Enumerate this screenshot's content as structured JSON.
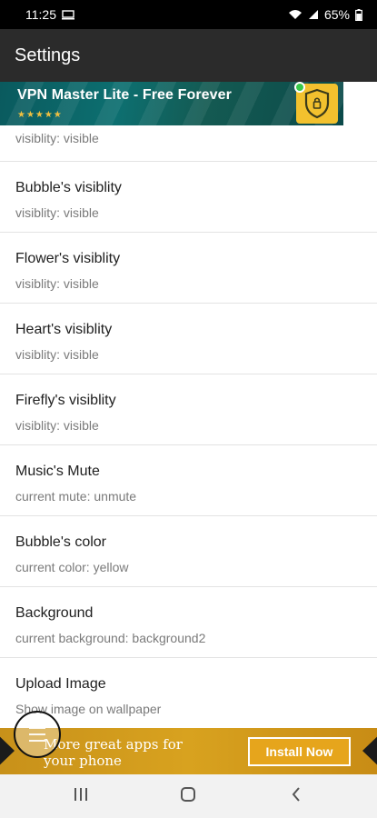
{
  "status_bar": {
    "time": "11:25",
    "battery": "65%",
    "icons": [
      "screen-record-icon",
      "wifi-icon",
      "signal-icon",
      "battery-icon"
    ]
  },
  "app_bar": {
    "title": "Settings"
  },
  "ad_top": {
    "title": "VPN Master Lite - Free Forever",
    "stars": "★★★★★",
    "icon": "shield-lock-icon"
  },
  "settings": {
    "partial_item": {
      "subtitle": "visiblity: visible"
    },
    "items": [
      {
        "title": "Bubble's visiblity",
        "subtitle": "visiblity: visible"
      },
      {
        "title": "Flower's visiblity",
        "subtitle": "visiblity: visible"
      },
      {
        "title": "Heart's visiblity",
        "subtitle": "visiblity: visible"
      },
      {
        "title": "Firefly's visiblity",
        "subtitle": "visiblity: visible"
      },
      {
        "title": "Music's Mute",
        "subtitle": "current mute: unmute"
      },
      {
        "title": "Bubble's color",
        "subtitle": "current color: yellow"
      },
      {
        "title": "Background",
        "subtitle": "current background: background2"
      },
      {
        "title": "Upload Image",
        "subtitle": "Show image on wallpaper"
      }
    ]
  },
  "ad_bottom": {
    "text": "More great apps for your phone",
    "install_label": "Install Now"
  },
  "fab": {
    "icon": "menu-icon"
  },
  "nav_bar": {
    "icons": [
      "recent-apps-icon",
      "home-icon",
      "back-icon"
    ]
  },
  "colors": {
    "app_bar": "#2b2b2b",
    "status_bar": "#000000",
    "ad_bottom": "#d8a21f",
    "nav_bar": "#f2f2f2"
  }
}
